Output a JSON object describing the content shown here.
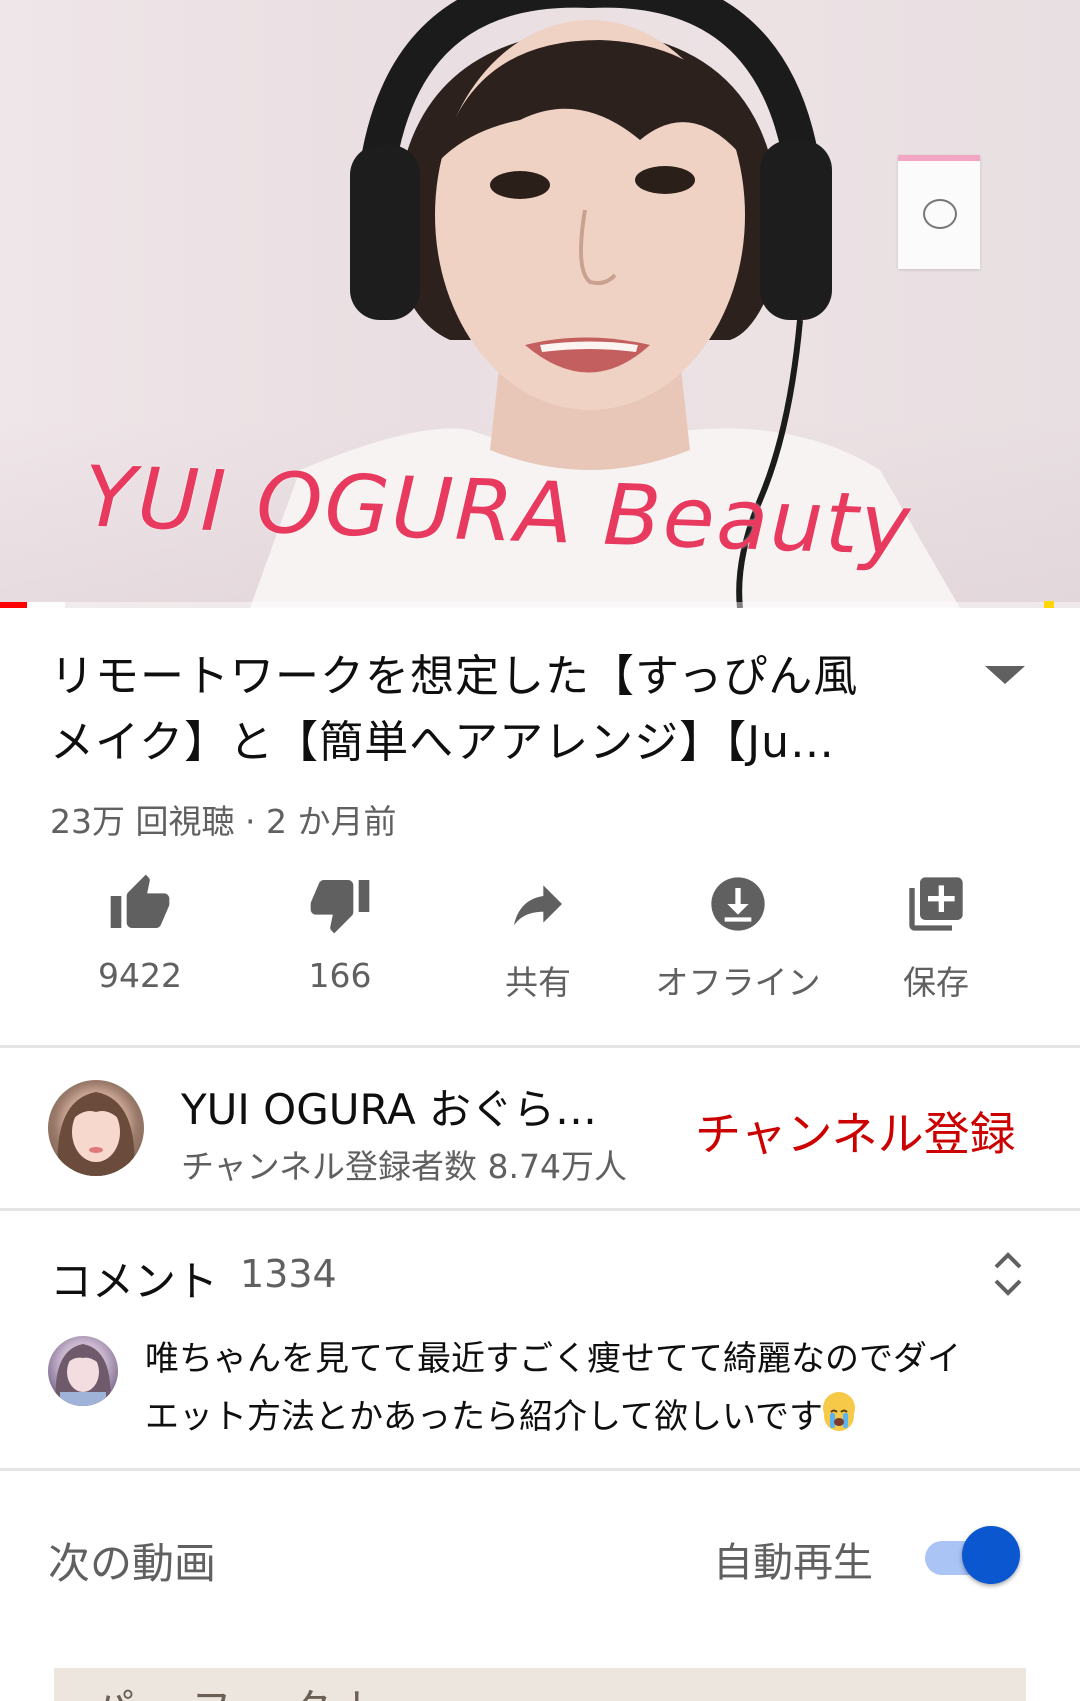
{
  "video": {
    "watermark_text": "YUI OGURA Beauty",
    "progress_fraction": 0.025,
    "buffered_fraction": 0.06,
    "colors": {
      "played": "#ff0000",
      "watermark": "#e83a5e"
    }
  },
  "title": {
    "line1": "リモートワークを想定した【すっぴん風",
    "line2": "メイク】と【簡単へアアレンジ】【Ju…",
    "expand_icon": "chevron-down-icon"
  },
  "meta": {
    "views": "23万 回視聴",
    "separator": " · ",
    "age": "2 か月前"
  },
  "actions": [
    {
      "icon": "thumbs-up-icon",
      "label": "9422"
    },
    {
      "icon": "thumbs-down-icon",
      "label": "166"
    },
    {
      "icon": "share-icon",
      "label": "共有"
    },
    {
      "icon": "download-icon",
      "label": "オフライン"
    },
    {
      "icon": "add-to-playlist-icon",
      "label": "保存"
    }
  ],
  "channel": {
    "name": "YUI OGURA おぐら…",
    "subscribers": "チャンネル登録者数 8.74万人",
    "subscribe_label": "チャンネル登録",
    "subscribe_color": "#cc0000"
  },
  "comments": {
    "header": "コメント",
    "count": "1334",
    "sort_icon": "expand-collapse-icon",
    "top_comment_line1": "唯ちゃんを見てて最近すごく痩せてて綺麗なのでダイ",
    "top_comment_line2": "エット方法とかあったら紹介して欲しいです",
    "top_comment_emoji": "loudly-crying-face-emoji"
  },
  "up_next": {
    "label": "次の動画",
    "autoplay_label": "自動再生",
    "autoplay_on": true,
    "toggle_color": "#0b57d0",
    "next_thumbnail_text": "パーフェクト"
  }
}
